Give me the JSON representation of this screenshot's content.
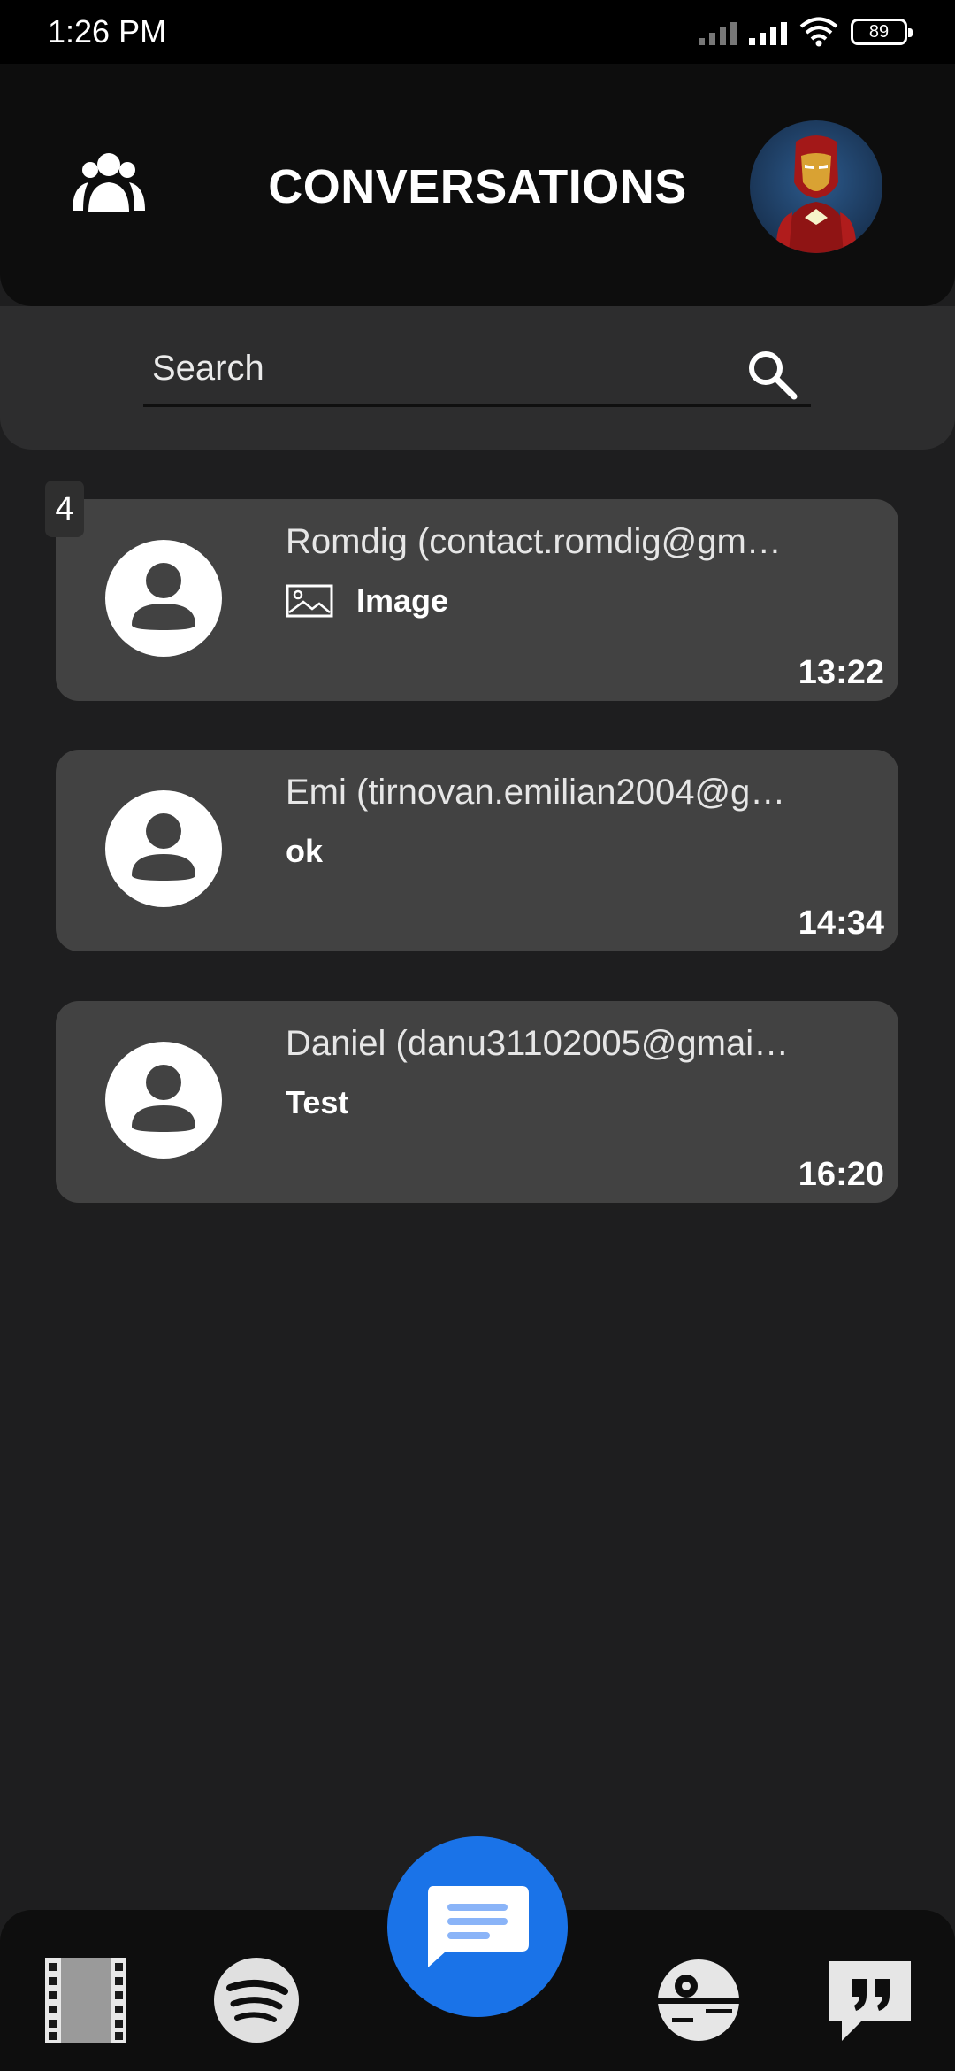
{
  "status_bar": {
    "time": "1:26 PM",
    "battery": "89"
  },
  "header": {
    "title": "CONVERSATIONS"
  },
  "search": {
    "placeholder": "Search"
  },
  "unread_count": "4",
  "conversations": [
    {
      "name": "Romdig (contact.romdig@gm…",
      "message": "Image",
      "has_image_icon": true,
      "time": "13:22"
    },
    {
      "name": "Emi (tirnovan.emilian2004@g…",
      "message": "ok",
      "has_image_icon": false,
      "time": "14:34"
    },
    {
      "name": "Daniel (danu31102005@gmai…",
      "message": "Test",
      "has_image_icon": false,
      "time": "16:20"
    }
  ],
  "bottom_nav": {
    "items": [
      "film-strip-icon",
      "spotify-icon",
      "messages-icon",
      "death-star-icon",
      "quote-icon"
    ],
    "active": "messages-icon"
  },
  "colors": {
    "accent": "#1a73e8",
    "card": "#424242",
    "background": "#1e1e1f",
    "header": "#0d0d0d"
  }
}
